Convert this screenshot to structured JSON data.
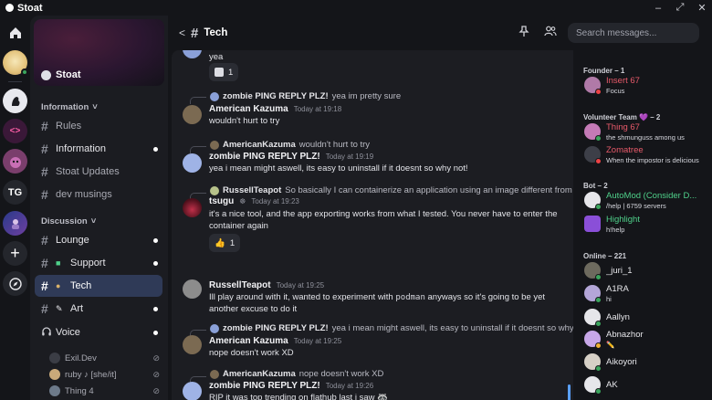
{
  "app": {
    "title": "Stoat",
    "window_controls": [
      "–",
      "⤢",
      "✕"
    ]
  },
  "rail": {
    "tg_label": "TG",
    "add_glyph": "+",
    "code_glyph": "<>"
  },
  "server": {
    "name": "Stoat"
  },
  "sidebar": {
    "categories": [
      {
        "label": "Information",
        "chevron": "˅"
      },
      {
        "label": "Discussion",
        "chevron": "˅"
      }
    ],
    "channels": [
      {
        "label": "Rules"
      },
      {
        "label": "Information"
      },
      {
        "label": "Stoat Updates"
      },
      {
        "label": "dev musings"
      },
      {
        "label": "Lounge"
      },
      {
        "label": "Support"
      },
      {
        "label": "Tech"
      },
      {
        "label": "Art"
      },
      {
        "label": "Voice"
      }
    ],
    "voice_users": [
      {
        "name": "Exil.Dev"
      },
      {
        "name": "ruby ♪ [she/it]"
      },
      {
        "name": "Thing 4"
      }
    ]
  },
  "header": {
    "back": "<",
    "hash": "#",
    "channel": "Tech",
    "search_placeholder": "Search messages..."
  },
  "messages": [
    {
      "text": "yea",
      "reaction_count": "1"
    },
    {
      "reply_author": "zombie PING REPLY PLZ!",
      "reply_text": "yea im pretty sure",
      "author": "American Kazuma",
      "time": "Today at 19:18",
      "text": "wouldn't hurt to try"
    },
    {
      "reply_author": "AmericanKazuma",
      "reply_text": "wouldn't hurt to try",
      "author": "zombie PING REPLY PLZ!",
      "time": "Today at 19:19",
      "text": "yea i mean might aswell, its easy to uninstall if it doesnt so why not!"
    },
    {
      "reply_author": "RussellTeapot",
      "reply_text": "So basically I can containerize an application using an image different from my",
      "author": "tsugu",
      "author_badge": "☸",
      "time": "Today at 19:23",
      "text": "it's a nice tool, and the app exporting works from what I tested. You never have to enter the container again",
      "reaction_emoji": "👍",
      "reaction_count": "1"
    },
    {
      "author": "RussellTeapot",
      "time": "Today at 19:25",
      "text_before": "Ill play around with it, wanted to experiment with ",
      "text_code": "podman",
      "text_after": " anyways so it's going to be yet another excuse to do it"
    },
    {
      "reply_author": "zombie PING REPLY PLZ!",
      "reply_text": "yea i mean might aswell, its easy to uninstall if it doesnt so why not",
      "author": "American Kazuma",
      "time": "Today at 19:25",
      "text": "nope doesn't work XD"
    },
    {
      "reply_author": "AmericanKazuma",
      "reply_text": "nope doesn't work XD",
      "author": "zombie PING REPLY PLZ!",
      "time": "Today at 19:26",
      "text": "RIP it was top trending on flathub last i saw 🦝"
    }
  ],
  "members": {
    "groups": [
      {
        "label": "Founder – 1"
      },
      {
        "label": "Volunteer Team 💜 – 2"
      },
      {
        "label": "Bot – 2"
      },
      {
        "label": "Online – 221"
      }
    ],
    "list": [
      {
        "name": "Insert 67",
        "sub": "Focus",
        "color": "#e85a6a"
      },
      {
        "name": "Thing 67",
        "sub": "the shmunguss among us",
        "color": "#e85a6a"
      },
      {
        "name": "Zomatree",
        "sub": "When the impostor is delicious",
        "color": "#e85a6a"
      },
      {
        "name": "AutoMod (Consider D...",
        "sub": "/help | 6759 servers",
        "color": "#4fd08a"
      },
      {
        "name": "Highlight",
        "sub": "h!help",
        "color": "#4fd08a"
      },
      {
        "name": "_juri_1",
        "sub": "",
        "color": "#e6e6ea"
      },
      {
        "name": "A1RA",
        "sub": "hi",
        "color": "#e6e6ea"
      },
      {
        "name": "Aallyn",
        "sub": "",
        "color": "#e6e6ea"
      },
      {
        "name": "Abnazhor",
        "sub": "✏️",
        "color": "#e6e6ea"
      },
      {
        "name": "Aikoyori",
        "sub": "",
        "color": "#e6e6ea"
      },
      {
        "name": "AK",
        "sub": "",
        "color": "#e6e6ea"
      }
    ]
  },
  "colors": {
    "accent": "#2f3a57",
    "online": "#3ba55d",
    "idle": "#f0b232",
    "dnd": "#ed4245",
    "role_red": "#e85a6a",
    "role_green": "#4fd08a"
  }
}
